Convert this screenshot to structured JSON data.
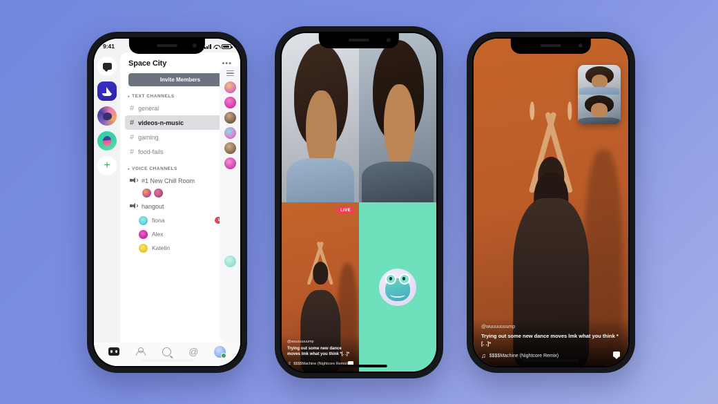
{
  "background": {
    "from": "#7186dd",
    "to": "#a6b1e8"
  },
  "phone1": {
    "status": {
      "time": "9:41",
      "signal_icon": "signal-bars-icon",
      "wifi_icon": "wifi-icon",
      "battery_icon": "battery-icon"
    },
    "server_rail": [
      {
        "name": "direct-messages",
        "icon": "chat-bubble-icon"
      },
      {
        "name": "space-city",
        "icon": "sailboat-server-icon",
        "active": true
      },
      {
        "name": "server-2",
        "icon": "server-avatar-icon"
      },
      {
        "name": "server-3",
        "icon": "server-avatar-icon"
      },
      {
        "name": "add-server",
        "icon": "plus-icon",
        "label": "+"
      }
    ],
    "header": {
      "title": "Space City",
      "overflow": "•••"
    },
    "invite_button": "Invite Members",
    "text_channels": {
      "category": "TEXT CHANNELS",
      "items": [
        {
          "name": "general",
          "selected": false
        },
        {
          "name": "videos-n-music",
          "selected": true
        },
        {
          "name": "gaming",
          "selected": false
        },
        {
          "name": "food-fails",
          "selected": false
        }
      ]
    },
    "voice_channels": {
      "category": "VOICE CHANNELS",
      "rooms": [
        {
          "name": "#1 New Chill Room",
          "avatars": 2,
          "members": []
        },
        {
          "name": "hangout",
          "avatars": 0,
          "members": [
            {
              "name": "fiona",
              "badge": "LIVE",
              "video": false
            },
            {
              "name": "Alex",
              "badge": "",
              "video": true
            },
            {
              "name": "Katelin",
              "badge": "",
              "video": true
            }
          ]
        }
      ]
    },
    "tabbar": [
      {
        "name": "home",
        "icon": "discord-logo-icon",
        "active": true
      },
      {
        "name": "friends",
        "icon": "friends-icon"
      },
      {
        "name": "search",
        "icon": "search-icon"
      },
      {
        "name": "mentions",
        "icon": "at-icon",
        "label": "@"
      },
      {
        "name": "profile",
        "icon": "avatar-icon"
      }
    ]
  },
  "phone2": {
    "live_badge": "LIVE",
    "overlay": {
      "username": "@wuuuuuuump",
      "caption": "Trying out some new dance moves lmk what you think *[. .]*",
      "song": "$$$$Machine (Nightcore Remix)",
      "note_icon": "music-note-icon",
      "chat_icon": "comment-bubble-icon"
    },
    "mint_pane": {
      "color": "#6ee0bb",
      "avatar_icon": "frog-avatar-icon"
    }
  },
  "phone3": {
    "overlay": {
      "username": "@wuuuuuuump",
      "caption": "Trying out some new dance moves lmk what you think *[. .]*",
      "song": "$$$$Machine (Nightcore Remix)",
      "note_icon": "music-note-icon",
      "chat_icon": "comment-bubble-icon"
    },
    "pip": {
      "tiles": 2
    }
  }
}
